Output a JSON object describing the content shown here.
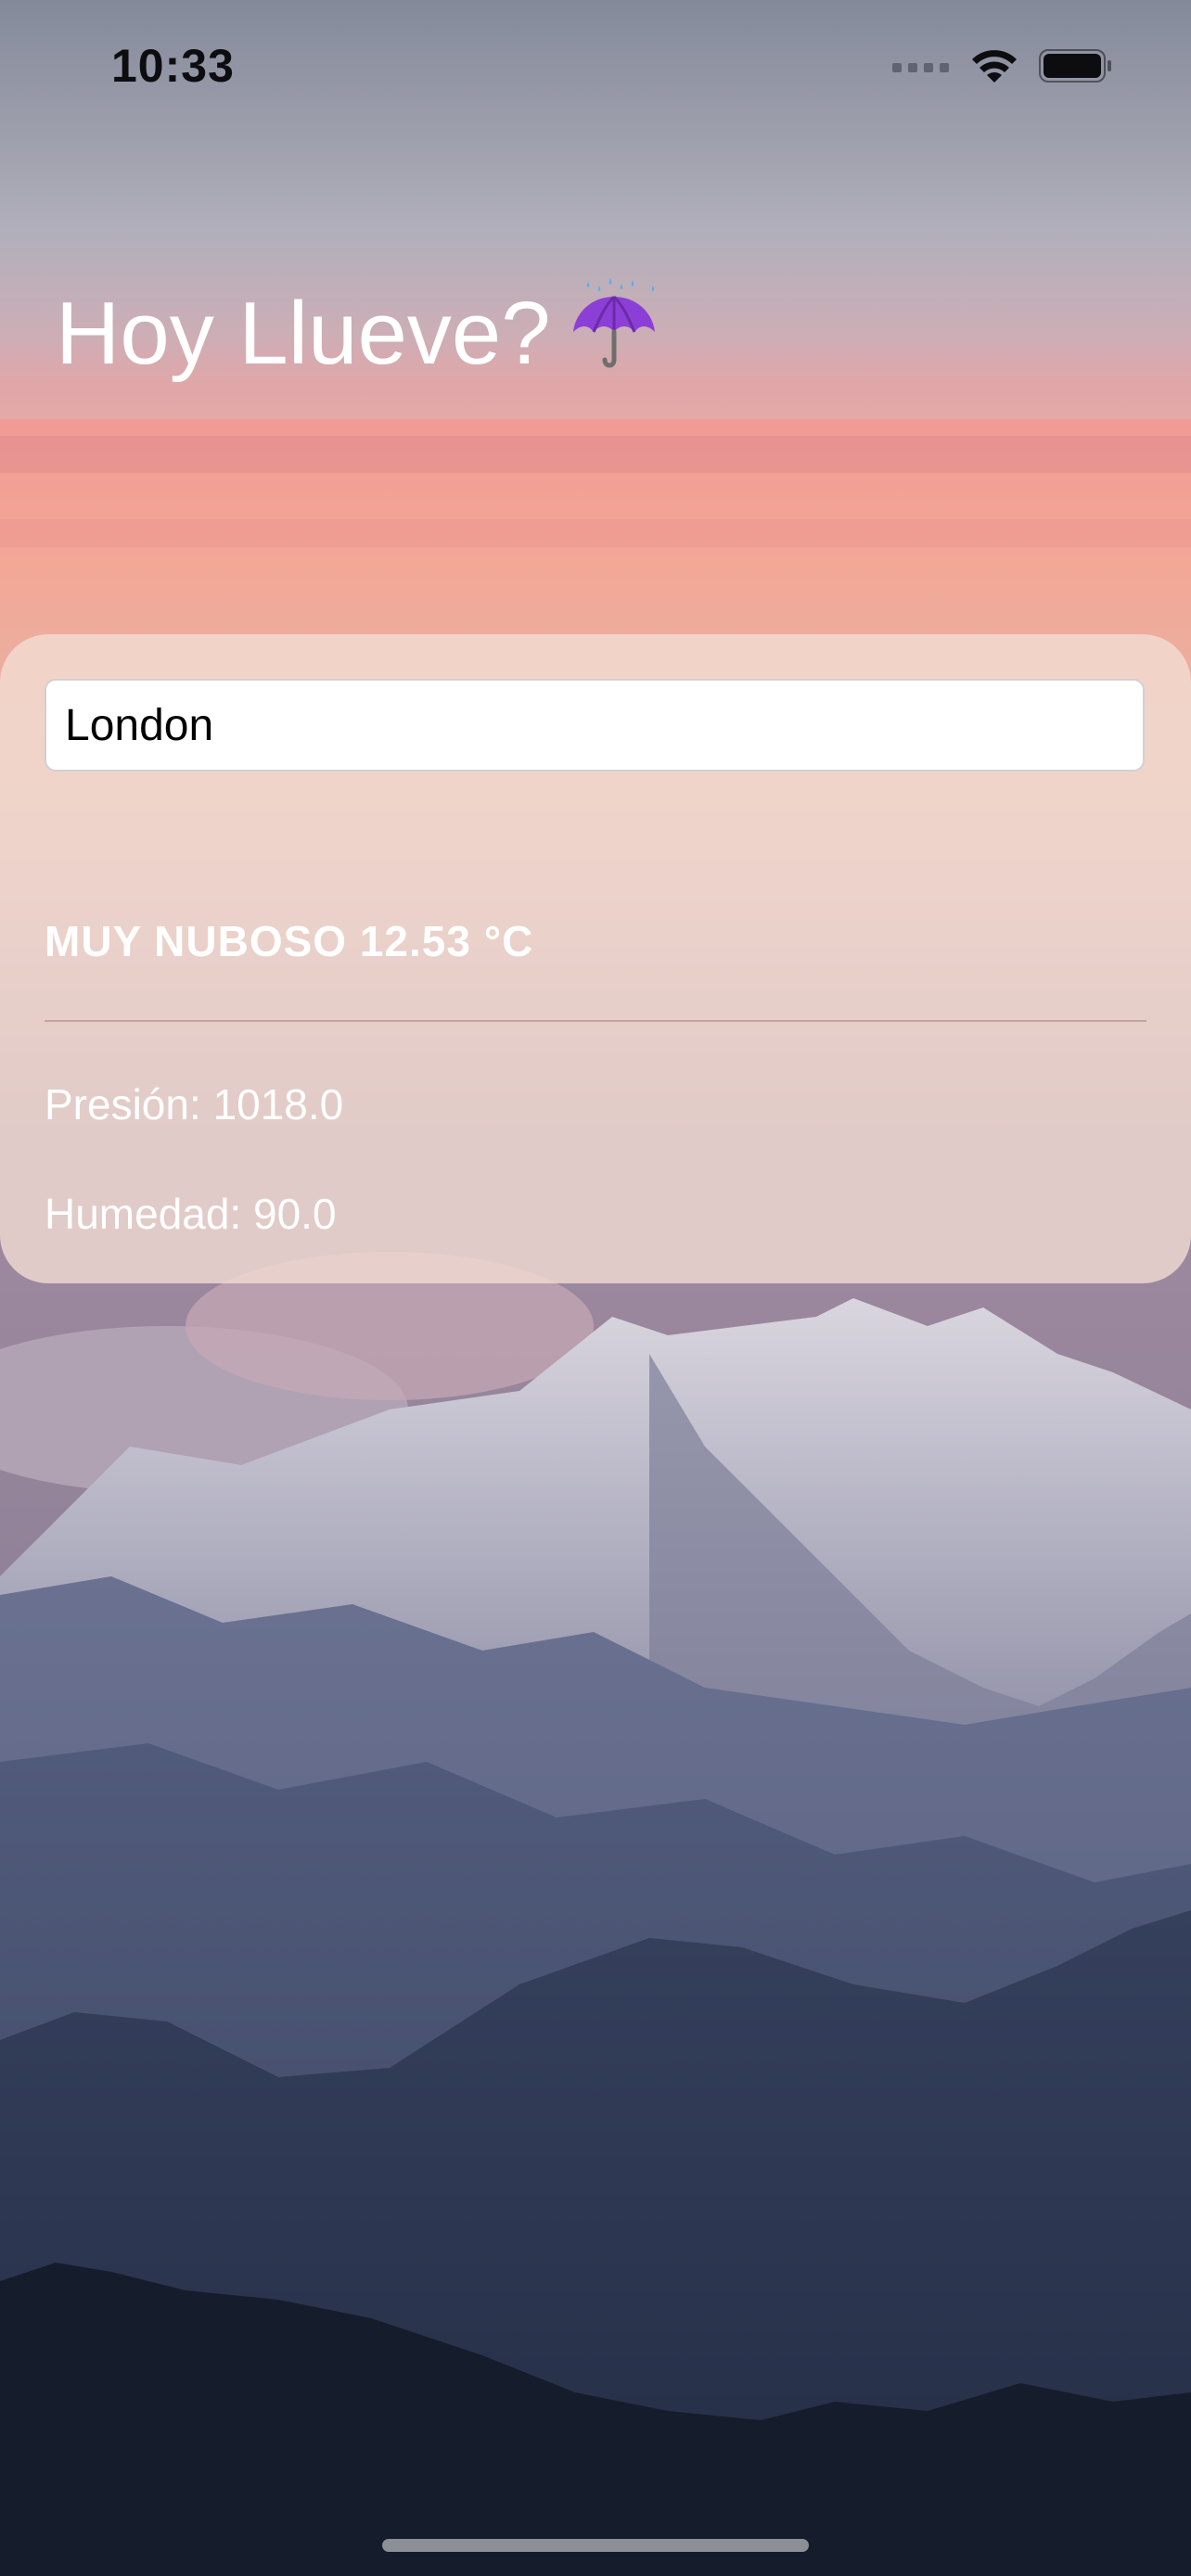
{
  "status_bar": {
    "time": "10:33",
    "icons": [
      "cellular-signal-icon",
      "wifi-icon",
      "battery-icon"
    ]
  },
  "nav": {
    "title": "Hoy Llueve?",
    "title_icon": "umbrella-with-rain-icon"
  },
  "weather": {
    "city_input": {
      "value": "London",
      "placeholder": ""
    },
    "condition": "MUY NUBOSO 12.53 °C",
    "pressure": "Presión: 1018.0",
    "humidity": "Humedad: 90.0"
  },
  "colors": {
    "sky_top": "#8a8fa0",
    "sunset_pink": "#f59a92",
    "card_overlay": "#f3ded4",
    "mountain_dark": "#1c2438",
    "text_light": "#ffffff"
  }
}
